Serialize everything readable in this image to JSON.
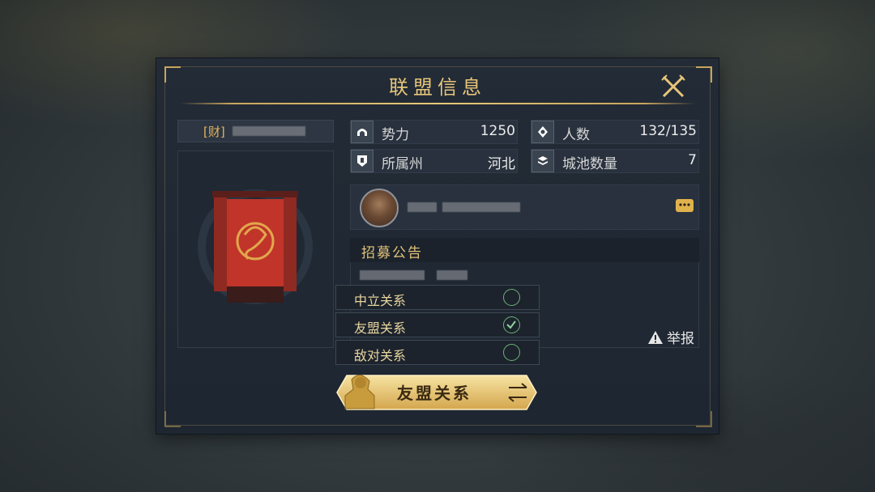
{
  "dialog": {
    "title": "联盟信息"
  },
  "alliance": {
    "name_tag": "[财]"
  },
  "stats": [
    {
      "icon": "power-icon",
      "label": "势力",
      "value": "1250"
    },
    {
      "icon": "members-icon",
      "label": "人数",
      "value": "132/135"
    },
    {
      "icon": "region-icon",
      "label": "所属州",
      "value": "河北"
    },
    {
      "icon": "cities-icon",
      "label": "城池数量",
      "value": "7"
    }
  ],
  "leader": {
    "avatar_icon": "leader-avatar",
    "chat_icon": "chat-bubble-icon"
  },
  "notice": {
    "title": "招募公告"
  },
  "report": {
    "label": "举报",
    "icon": "warning-triangle-icon"
  },
  "relation_options": [
    {
      "label": "中立关系",
      "selected": false
    },
    {
      "label": "友盟关系",
      "selected": true
    },
    {
      "label": "敌对关系",
      "selected": false
    }
  ],
  "relation_button": {
    "label": "友盟关系",
    "icon": "swap-arrows-icon"
  },
  "colors": {
    "gold": "#e7c67a",
    "accent_green": "#6fb07a",
    "banner_red": "#c0342a"
  }
}
